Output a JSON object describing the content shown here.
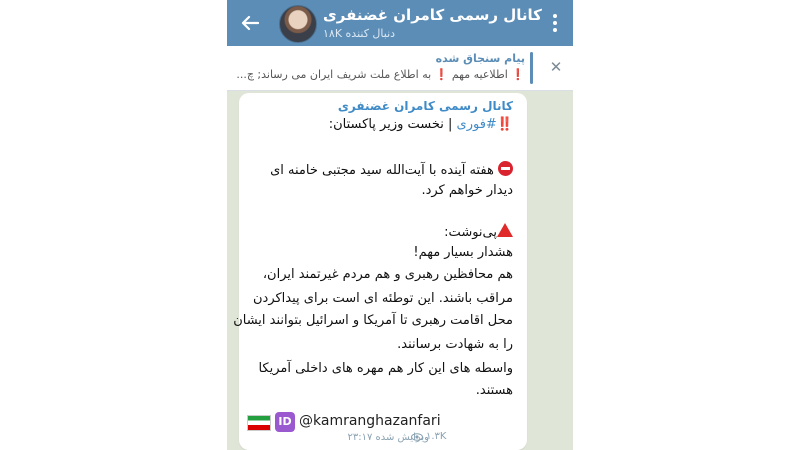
{
  "header": {
    "title": "کانال رسمی کامران غضنفری",
    "subtitle": "دنبال کننده ۱۸K"
  },
  "pinned": {
    "label": "پیام سنجاق شده",
    "text": "اطلاعیه مهم ❗ به اطلاع ملت شریف ایران می رساند; چ..."
  },
  "message": {
    "sender": "کانال رسمی کامران غضنفری",
    "line1_hashtag": "#فوری",
    "line1_rest": " | نخست وزیر پاکستان:",
    "line2": "هفته آینده با آیت‌الله سید مجتبی خامنه ای",
    "line3": "دیدار خواهم کرد.",
    "line4": "پی‌نوشت:",
    "line5": "هشدار بسیار مهم!",
    "line6": "هم محافظین رهبری و هم مردم غیرتمند ایران،",
    "line7": "مراقب باشند. این توطئه ای است برای پیداکردن",
    "line8": "محل اقامت رهبری تا آمریکا و اسرائیل بتوانند ایشان",
    "line9": "را به شهادت برسانند.",
    "line10": "واسطه های این کار هم مهره های داخلی آمریکا",
    "line11": "هستند.",
    "handle": "@kamranghazanfari",
    "id_badge": "ID",
    "views": "۱.۳K",
    "time_meta": "ویرایش شده ۲۳:۱۷"
  },
  "colors": {
    "header_bg": "#5b8db6",
    "chat_bg": "#dfe6d8",
    "link": "#3f8bc7",
    "alert_red": "#d21f1f"
  },
  "icons": {
    "back": "arrow-left-icon",
    "menu": "kebab-menu-icon",
    "close": "close-icon",
    "views": "eye-icon"
  }
}
